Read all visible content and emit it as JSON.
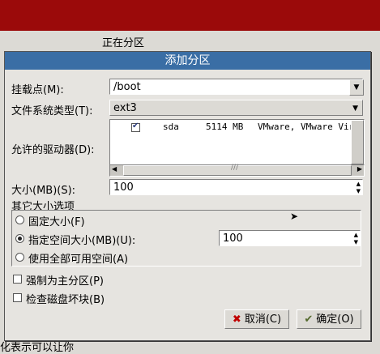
{
  "background": {
    "partition_label": "正在分区",
    "bottom_text": "化表示可以让你"
  },
  "dialog": {
    "title": "添加分区",
    "mount_point": {
      "label": "挂载点(M):",
      "value": "/boot"
    },
    "fs_type": {
      "label": "文件系统类型(T):",
      "value": "ext3"
    },
    "drives": {
      "label": "允许的驱动器(D):",
      "rows": [
        {
          "name": "sda",
          "size": "5114 MB",
          "model": "VMware, VMware Virtua"
        }
      ]
    },
    "size": {
      "label": "大小(MB)(S):",
      "value": "100"
    },
    "other_size": {
      "legend": "其它大小选项",
      "fixed": "固定大小(F)",
      "fill_up_to": "指定空间大小(MB)(U):",
      "fill_up_to_value": "100",
      "fill_all": "使用全部可用空间(A)"
    },
    "force_primary": "强制为主分区(P)",
    "check_bad_blocks": "检查磁盘坏块(B)",
    "cancel_label": "取消(C)",
    "ok_label": "确定(O)"
  }
}
